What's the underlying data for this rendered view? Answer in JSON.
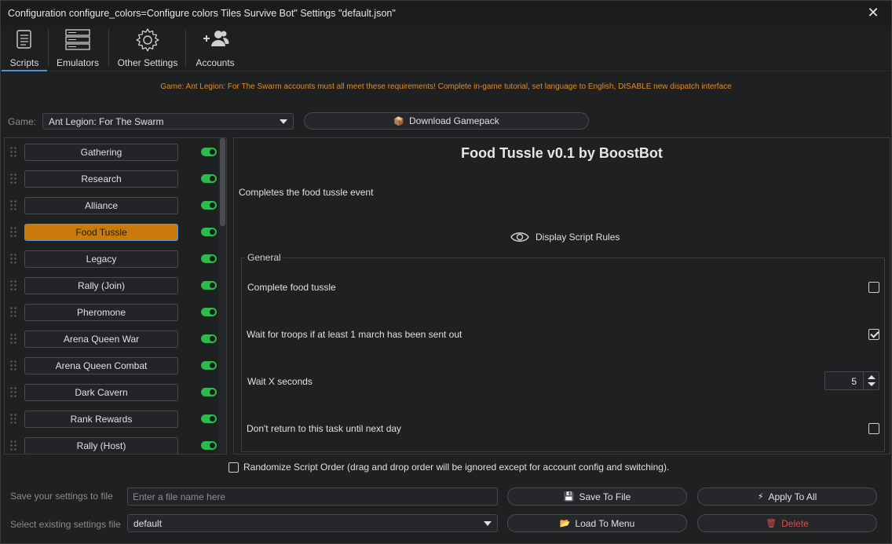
{
  "window": {
    "title": "Configuration configure_colors=Configure colors Tiles Survive Bot\" Settings \"default.json\""
  },
  "toolbar": {
    "tabs": [
      {
        "label": "Scripts",
        "icon": "scroll-icon"
      },
      {
        "label": "Emulators",
        "icon": "server-icon"
      },
      {
        "label": "Other Settings",
        "icon": "gear-icon"
      },
      {
        "label": "Accounts",
        "icon": "users-add-icon"
      }
    ],
    "active_tab": "Scripts"
  },
  "notice": "Game: Ant Legion: For The Swarm accounts must all meet these requirements! Complete in-game tutorial, set language to English, DISABLE new dispatch interface",
  "game": {
    "label": "Game:",
    "selected": "Ant Legion: For The Swarm",
    "download_label": "Download Gamepack"
  },
  "scripts": [
    {
      "label": "Gathering",
      "enabled": true
    },
    {
      "label": "Research",
      "enabled": true
    },
    {
      "label": "Alliance",
      "enabled": true
    },
    {
      "label": "Food Tussle",
      "enabled": true,
      "selected": true
    },
    {
      "label": "Legacy",
      "enabled": true
    },
    {
      "label": "Rally (Join)",
      "enabled": true
    },
    {
      "label": "Pheromone",
      "enabled": true
    },
    {
      "label": "Arena Queen War",
      "enabled": true
    },
    {
      "label": "Arena Queen Combat",
      "enabled": true
    },
    {
      "label": "Dark Cavern",
      "enabled": true
    },
    {
      "label": "Rank Rewards",
      "enabled": true
    },
    {
      "label": "Rally (Host)",
      "enabled": true
    }
  ],
  "detail": {
    "title": "Food Tussle v0.1 by BoostBot",
    "description": "Completes the food tussle event",
    "rules_label": "Display Script Rules",
    "group_title": "General",
    "options": [
      {
        "label": "Complete food tussle",
        "type": "checkbox",
        "checked": false
      },
      {
        "label": "Wait for troops if at least 1 march has been sent out",
        "type": "checkbox",
        "checked": true
      },
      {
        "label": "Wait X seconds",
        "type": "spinbox",
        "value": "5"
      },
      {
        "label": "Don't return to this task until next day",
        "type": "checkbox",
        "checked": false
      }
    ]
  },
  "randomize": {
    "label": "Randomize Script Order (drag and drop order will be ignored except for account config and switching).",
    "checked": false
  },
  "bottom": {
    "save_label": "Save your settings to file",
    "save_placeholder": "Enter a file name here",
    "select_label": "Select existing settings file",
    "select_value": "default",
    "save_to_file": "Save To File",
    "apply_to_all": "Apply To All",
    "load_to_menu": "Load To Menu",
    "delete": "Delete"
  },
  "colors": {
    "accent": "#4a8ed8",
    "selected_script": "#c97a0a",
    "toggle_on": "#2fb84b",
    "notice": "#e08a2a",
    "danger": "#e04a4a"
  }
}
